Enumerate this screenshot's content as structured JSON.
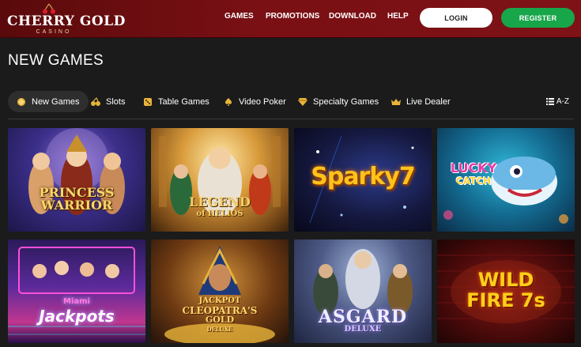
{
  "header": {
    "logo_text": "CHERRY GOLD",
    "logo_sub": "CASINO",
    "nav": [
      "GAMES",
      "PROMOTIONS",
      "DOWNLOAD",
      "HELP"
    ],
    "login_label": "LOGIN",
    "register_label": "REGISTER"
  },
  "page_title": "NEW GAMES",
  "tabs": [
    {
      "label": "New Games",
      "icon": "new-games-icon",
      "active": true
    },
    {
      "label": "Slots",
      "icon": "cherries-icon",
      "active": false
    },
    {
      "label": "Table Games",
      "icon": "dice-icon",
      "active": false
    },
    {
      "label": "Video Poker",
      "icon": "spade-icon",
      "active": false
    },
    {
      "label": "Specialty Games",
      "icon": "diamond-icon",
      "active": false
    },
    {
      "label": "Live Dealer",
      "icon": "crown-icon",
      "active": false
    }
  ],
  "sort_label": "A-Z",
  "games": [
    {
      "title_lines": [
        "PRINCESS",
        "WARRIOR"
      ]
    },
    {
      "title_lines": [
        "LEGEND",
        "of HELIOS"
      ]
    },
    {
      "title_lines": [
        "Sparky7"
      ]
    },
    {
      "title_lines": [
        "LUCKY",
        "CATCH"
      ]
    },
    {
      "title_lines": [
        "Miami",
        "Jackpots"
      ]
    },
    {
      "title_lines": [
        "JACKPOT",
        "CLEOPATRA'S",
        "GOLD",
        "DELUXE"
      ]
    },
    {
      "title_lines": [
        "ASGARD",
        "DELUXE"
      ]
    },
    {
      "title_lines": [
        "WILD",
        "FIRE 7s"
      ]
    }
  ],
  "colors": {
    "header_red": "#7a1014",
    "register_green": "#17a64a",
    "background": "#1b1b1b"
  }
}
